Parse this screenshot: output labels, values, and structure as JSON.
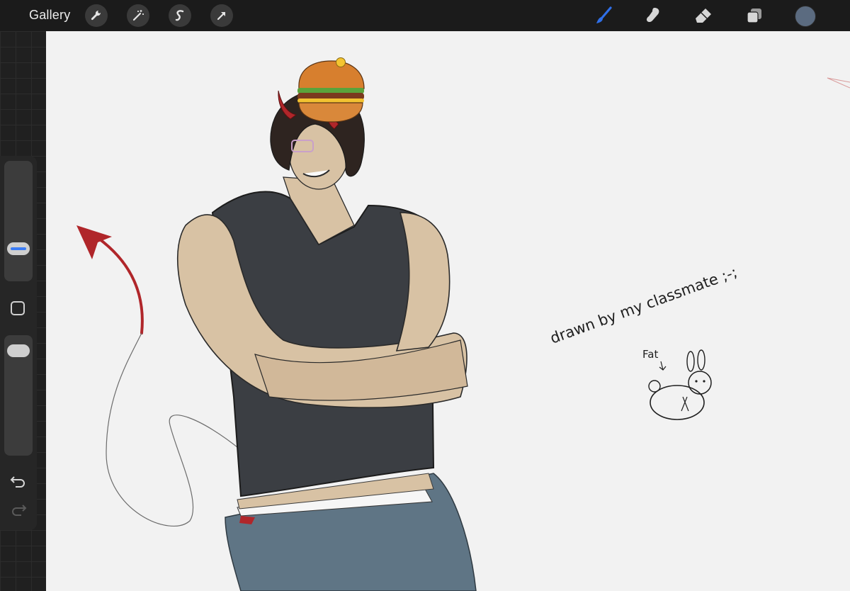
{
  "topbar": {
    "gallery_label": "Gallery",
    "left_tools": [
      {
        "icon": "wrench-icon"
      },
      {
        "icon": "magic-wand-icon"
      },
      {
        "icon": "selection-s-icon"
      },
      {
        "icon": "transform-arrow-icon"
      }
    ],
    "right_tools": [
      {
        "icon": "brush-icon",
        "active": true
      },
      {
        "icon": "smudge-icon",
        "active": false
      },
      {
        "icon": "eraser-icon",
        "active": false
      },
      {
        "icon": "layers-icon",
        "active": false
      }
    ],
    "current_color": "#5b6b80",
    "active_color": "#2f6fe8"
  },
  "sidebar": {
    "brush_size_level": 0.22,
    "opacity_level": 0.95,
    "modify_icon": "square-icon",
    "undo_icon": "undo-icon",
    "redo_icon": "redo-icon"
  },
  "canvas": {
    "note_text": "drawn by my classmate ;-;",
    "fat_label": "Fat",
    "arrow_color": "#b0262a"
  }
}
